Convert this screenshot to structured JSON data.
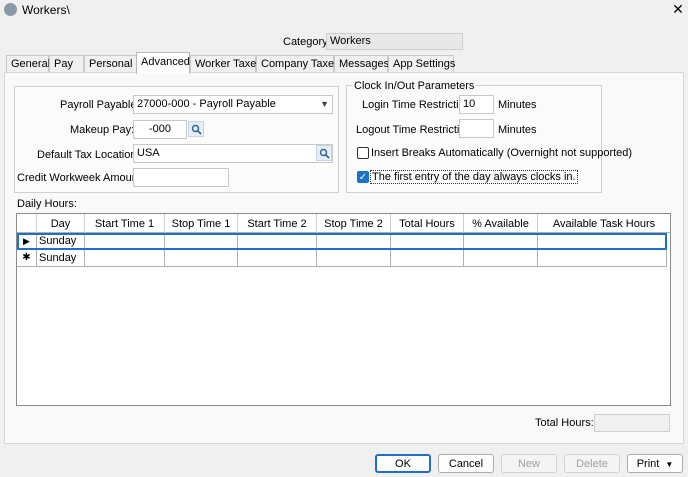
{
  "window": {
    "title": "Workers\\",
    "close_label": "✕"
  },
  "category": {
    "label": "Category:",
    "value": "Workers"
  },
  "tabs": [
    "General",
    "Pay",
    "Personal",
    "Advanced",
    "Worker Taxes",
    "Company Taxes",
    "Messages",
    "App Settings"
  ],
  "left": {
    "payroll_payable_label": "Payroll Payable:",
    "payroll_payable_value": "27000-000 - Payroll Payable",
    "makeup_pay_label": "Makeup Pay:",
    "makeup_pay_value": "-000",
    "default_tax_label": "Default Tax Location:",
    "default_tax_value": "USA",
    "credit_workweek_label": "Credit Workweek Amount:",
    "credit_workweek_value": ""
  },
  "clock": {
    "title": "Clock In/Out Parameters",
    "login_label": "Login Time Restriction:",
    "login_value": "10",
    "login_unit": "Minutes",
    "logout_label": "Logout Time Restriction:",
    "logout_value": "",
    "logout_unit": "Minutes",
    "insert_breaks_label": "Insert Breaks Automatically (Overnight not supported)",
    "insert_breaks_checked": false,
    "first_entry_label": "The first entry of the day always clocks in.",
    "first_entry_checked": true
  },
  "daily_hours": {
    "label": "Daily Hours:",
    "columns": [
      "Day",
      "Start Time 1",
      "Stop Time 1",
      "Start Time 2",
      "Stop Time 2",
      "Total Hours",
      "% Available",
      "Available Task Hours"
    ],
    "rows": [
      {
        "marker": "▶",
        "cells": [
          "Sunday",
          "",
          "",
          "",
          "",
          "",
          "",
          ""
        ]
      },
      {
        "marker": "✱",
        "cells": [
          "Sunday",
          "",
          "",
          "",
          "",
          "",
          "",
          ""
        ]
      }
    ]
  },
  "total_hours": {
    "label": "Total Hours:",
    "value": ""
  },
  "buttons": {
    "ok": "OK",
    "cancel": "Cancel",
    "new": "New",
    "delete": "Delete",
    "print": "Print"
  }
}
